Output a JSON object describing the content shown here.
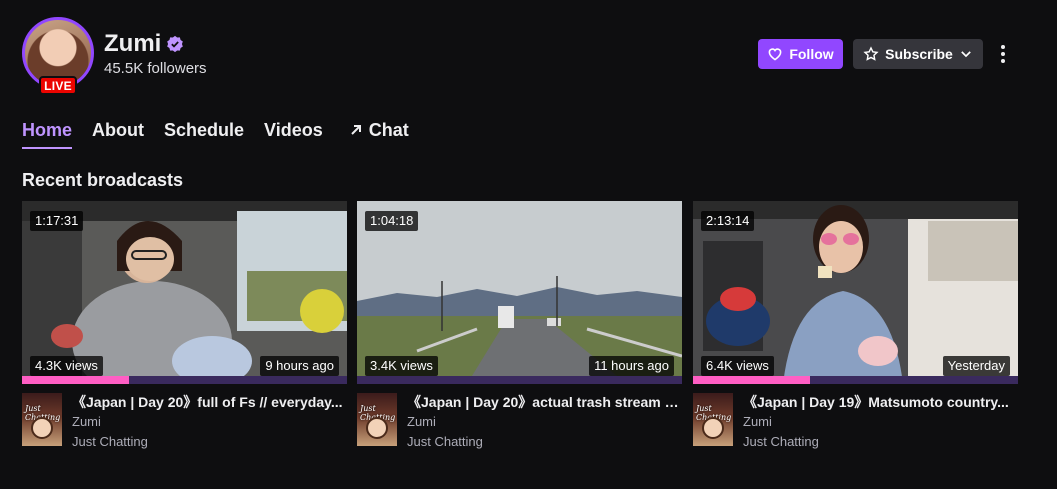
{
  "channel": {
    "name": "Zumi",
    "followers": "45.5K followers",
    "live_label": "LIVE"
  },
  "actions": {
    "follow_label": "Follow",
    "subscribe_label": "Subscribe"
  },
  "tabs": [
    {
      "label": "Home",
      "active": true
    },
    {
      "label": "About"
    },
    {
      "label": "Schedule"
    },
    {
      "label": "Videos"
    },
    {
      "label": "Chat",
      "icon": "external-arrow-icon"
    }
  ],
  "section": {
    "title": "Recent broadcasts"
  },
  "videos": [
    {
      "duration": "1:17:31",
      "views": "4.3K views",
      "age": "9 hours ago",
      "title": "《Japan | Day 20》full of Fs // everyday...",
      "channel": "Zumi",
      "category": "Just Chatting"
    },
    {
      "duration": "1:04:18",
      "views": "3.4K views",
      "age": "11 hours ago",
      "title": "《Japan | Day 20》actual trash stream (...",
      "channel": "Zumi",
      "category": "Just Chatting"
    },
    {
      "duration": "2:13:14",
      "views": "6.4K views",
      "age": "Yesterday",
      "title": "《Japan | Day 19》Matsumoto country...",
      "channel": "Zumi",
      "category": "Just Chatting"
    }
  ],
  "colors": {
    "accent": "#9147ff",
    "accent_text": "#bf94ff",
    "live": "#eb0400",
    "background": "#0e0e10"
  }
}
